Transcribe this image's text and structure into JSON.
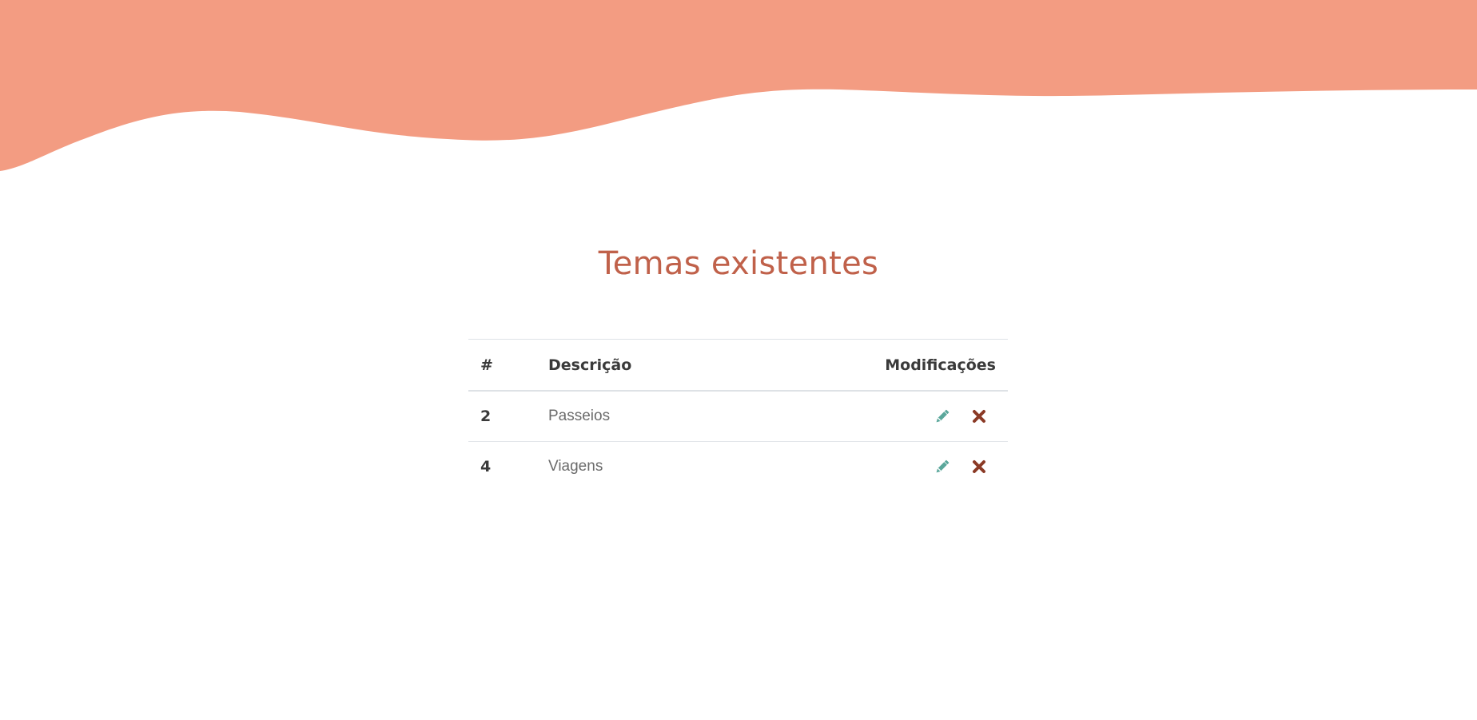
{
  "page": {
    "title": "Temas existentes"
  },
  "colors": {
    "wave": "#f39c82",
    "title": "#c0614a",
    "edit_icon": "#5aa79b",
    "delete_icon": "#8b3a26"
  },
  "table": {
    "headers": {
      "number": "#",
      "description": "Descrição",
      "modifications": "Modificações"
    },
    "rows": [
      {
        "id": "2",
        "description": "Passeios",
        "edit_icon": "pencil-icon",
        "delete_icon": "times-icon"
      },
      {
        "id": "4",
        "description": "Viagens",
        "edit_icon": "pencil-icon",
        "delete_icon": "times-icon"
      }
    ]
  }
}
